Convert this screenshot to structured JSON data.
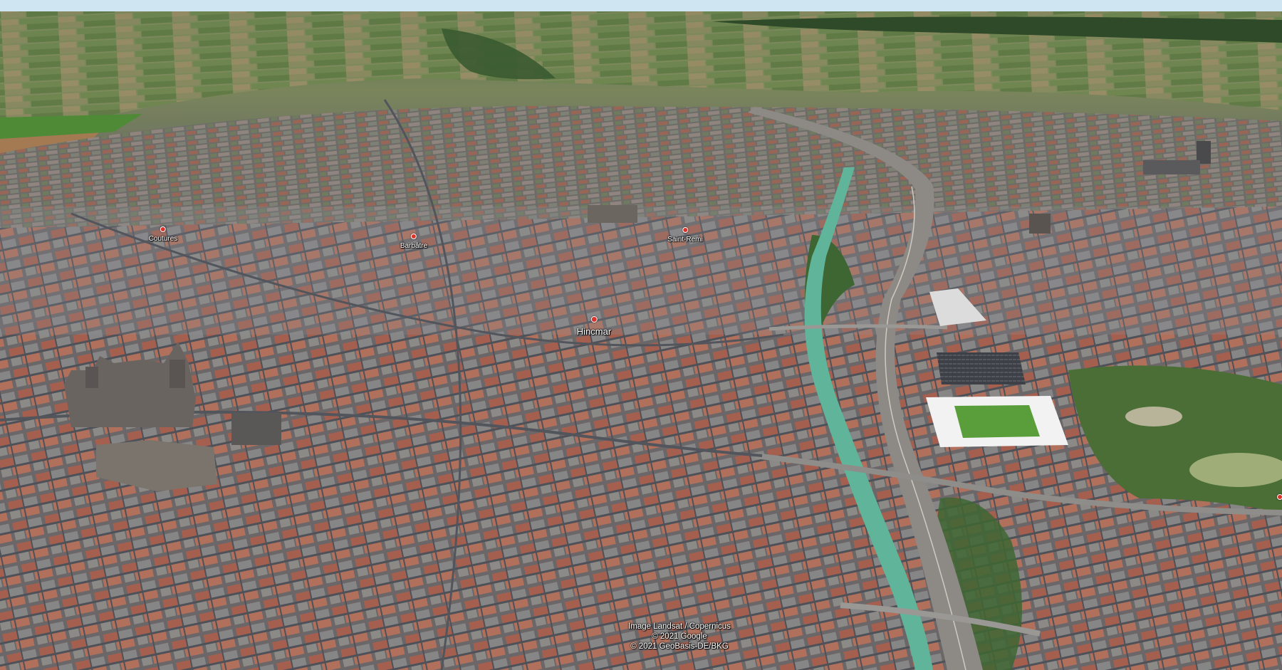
{
  "map": {
    "view": "3D aerial view",
    "colors": {
      "sky": "#cfe6f2",
      "fields": "#7a8a5e",
      "forest": "#2f4a28",
      "city": "#6a6a6e",
      "roofs": "#a8604e",
      "canal": "#5fb49a",
      "highway": "#8d8a86",
      "pitch": "#5a9e3c",
      "stands": "#f2f2f2",
      "pin": "#d9342b"
    },
    "places": [
      {
        "id": "couture",
        "label": "Coutures",
        "size": "small"
      },
      {
        "id": "barbatre",
        "label": "Barbâtre",
        "size": "small"
      },
      {
        "id": "saint-remi",
        "label": "Saint-Remi",
        "size": "small"
      },
      {
        "id": "hincmar",
        "label": "Hincmar",
        "size": "large"
      }
    ],
    "attribution": [
      "Image Landsat / Copernicus",
      "© 2021 Google",
      "© 2021 GeoBasis-DE/BKG"
    ]
  }
}
